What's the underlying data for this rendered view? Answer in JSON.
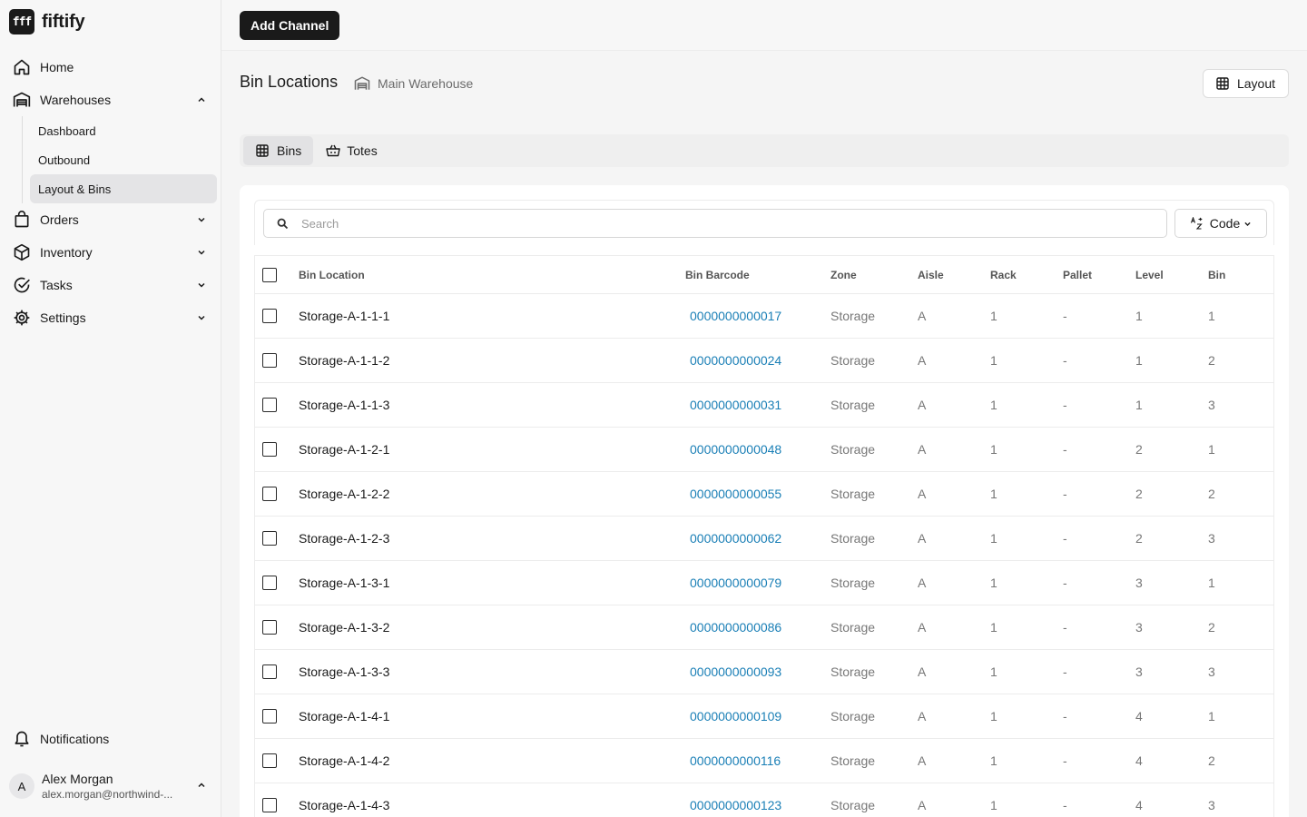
{
  "app": {
    "logo_text": "fff",
    "name": "fiftify"
  },
  "sidebar": {
    "items": [
      {
        "label": "Home"
      },
      {
        "label": "Warehouses",
        "sub": [
          {
            "label": "Dashboard"
          },
          {
            "label": "Outbound"
          },
          {
            "label": "Layout & Bins"
          }
        ]
      },
      {
        "label": "Orders"
      },
      {
        "label": "Inventory"
      },
      {
        "label": "Tasks"
      },
      {
        "label": "Settings"
      }
    ],
    "notifications": "Notifications",
    "user": {
      "initial": "A",
      "name": "Alex Morgan",
      "email": "alex.morgan@northwind-..."
    }
  },
  "topbar": {
    "add_channel_label": "Add Channel"
  },
  "page": {
    "title": "Bin Locations",
    "warehouse": "Main Warehouse",
    "layout_button": "Layout",
    "tabs": [
      {
        "label": "Bins"
      },
      {
        "label": "Totes"
      }
    ],
    "search_placeholder": "Search",
    "sort_label": "Code"
  },
  "table": {
    "columns": [
      "Bin Location",
      "Bin Barcode",
      "Zone",
      "Aisle",
      "Rack",
      "Pallet",
      "Level",
      "Bin"
    ],
    "rows": [
      [
        "Storage-A-1-1-1",
        "0000000000017",
        "Storage",
        "A",
        "1",
        "-",
        "1",
        "1"
      ],
      [
        "Storage-A-1-1-2",
        "0000000000024",
        "Storage",
        "A",
        "1",
        "-",
        "1",
        "2"
      ],
      [
        "Storage-A-1-1-3",
        "0000000000031",
        "Storage",
        "A",
        "1",
        "-",
        "1",
        "3"
      ],
      [
        "Storage-A-1-2-1",
        "0000000000048",
        "Storage",
        "A",
        "1",
        "-",
        "2",
        "1"
      ],
      [
        "Storage-A-1-2-2",
        "0000000000055",
        "Storage",
        "A",
        "1",
        "-",
        "2",
        "2"
      ],
      [
        "Storage-A-1-2-3",
        "0000000000062",
        "Storage",
        "A",
        "1",
        "-",
        "2",
        "3"
      ],
      [
        "Storage-A-1-3-1",
        "0000000000079",
        "Storage",
        "A",
        "1",
        "-",
        "3",
        "1"
      ],
      [
        "Storage-A-1-3-2",
        "0000000000086",
        "Storage",
        "A",
        "1",
        "-",
        "3",
        "2"
      ],
      [
        "Storage-A-1-3-3",
        "0000000000093",
        "Storage",
        "A",
        "1",
        "-",
        "3",
        "3"
      ],
      [
        "Storage-A-1-4-1",
        "0000000000109",
        "Storage",
        "A",
        "1",
        "-",
        "4",
        "1"
      ],
      [
        "Storage-A-1-4-2",
        "0000000000116",
        "Storage",
        "A",
        "1",
        "-",
        "4",
        "2"
      ],
      [
        "Storage-A-1-4-3",
        "0000000000123",
        "Storage",
        "A",
        "1",
        "-",
        "4",
        "3"
      ]
    ]
  }
}
